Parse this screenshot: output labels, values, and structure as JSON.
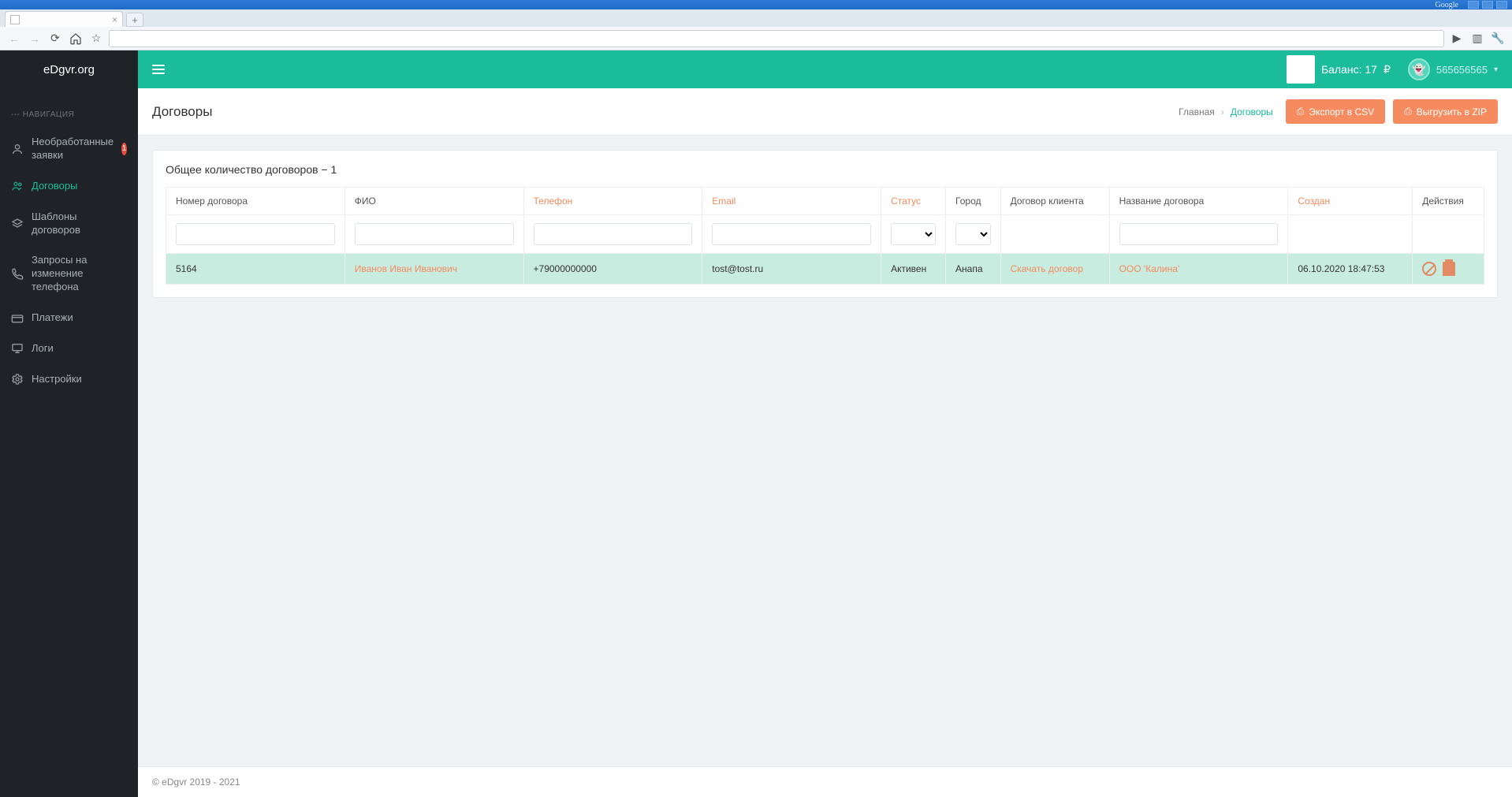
{
  "browser": {
    "google_label": "Google"
  },
  "brand": "eDgvr.org",
  "sidebar": {
    "heading": "--- НАВИГАЦИЯ",
    "items": [
      {
        "label": "Необработанные заявки",
        "badge": "1",
        "icon": "user-icon"
      },
      {
        "label": "Договоры",
        "active": true,
        "icon": "users-icon"
      },
      {
        "label": "Шаблоны договоров",
        "icon": "layers-icon"
      },
      {
        "label": "Запросы на изменение телефона",
        "icon": "phone-icon"
      },
      {
        "label": "Платежи",
        "icon": "card-icon"
      },
      {
        "label": "Логи",
        "icon": "monitor-icon"
      },
      {
        "label": "Настройки",
        "icon": "gear-icon"
      }
    ]
  },
  "topbar": {
    "balance_label": "Баланс: 17",
    "currency": "₽",
    "username": "565656565"
  },
  "page": {
    "title": "Договоры",
    "breadcrumb_home": "Главная",
    "breadcrumb_current": "Договоры",
    "export_csv": "Экспорт в CSV",
    "export_zip": "Выгрузить в ZIP"
  },
  "table": {
    "summary": "Общее количество договоров − 1",
    "columns": {
      "number": "Номер договора",
      "fio": "ФИО",
      "phone": "Телефон",
      "email": "Email",
      "status": "Статус",
      "city": "Город",
      "client_contract": "Договор клиента",
      "contract_name": "Название договора",
      "created": "Создан",
      "actions": "Действия"
    },
    "rows": [
      {
        "number": "5164",
        "fio": "Иванов Иван Иванович",
        "phone": "+79000000000",
        "email": "tost@tost.ru",
        "status": "Активен",
        "city": "Анапа",
        "client_contract": "Скачать договор",
        "contract_name": "ООО 'Калина'",
        "created": "06.10.2020 18:47:53"
      }
    ]
  },
  "footer": "© eDgvr 2019 - 2021"
}
